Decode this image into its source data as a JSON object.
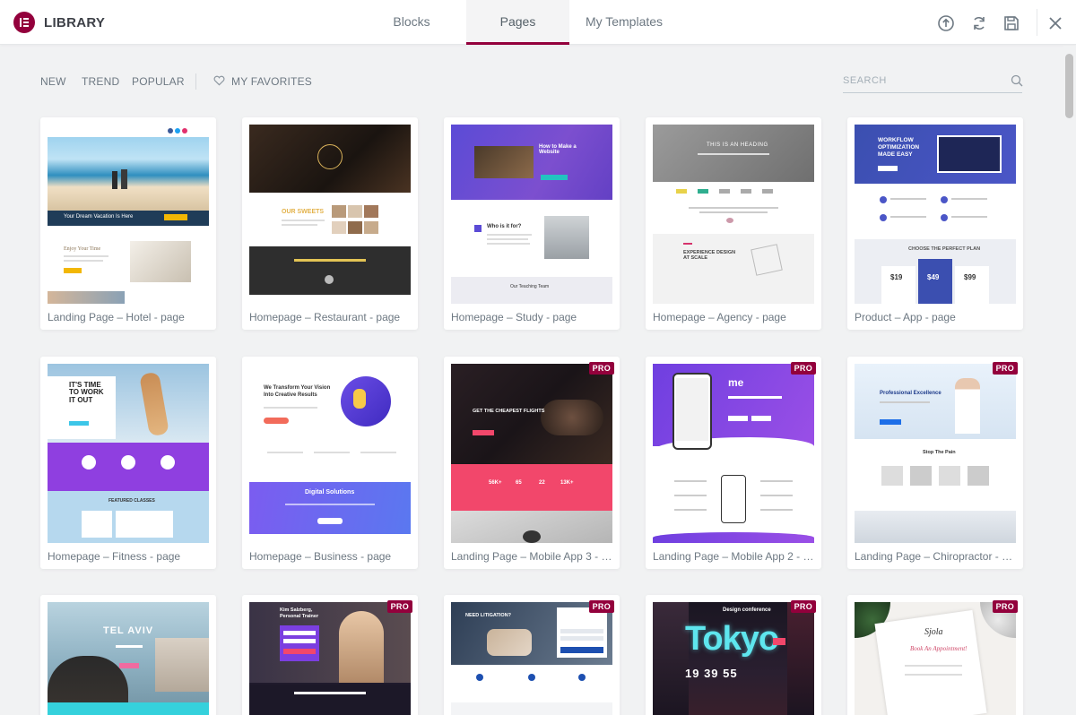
{
  "header": {
    "title": "LIBRARY",
    "tabs": [
      {
        "label": "Blocks",
        "active": false
      },
      {
        "label": "Pages",
        "active": true
      },
      {
        "label": "My Templates",
        "active": false
      }
    ],
    "icons": [
      "upload-icon",
      "sync-icon",
      "save-icon",
      "close-icon"
    ]
  },
  "toolbar": {
    "filters": [
      "NEW",
      "TREND",
      "POPULAR"
    ],
    "favorites_label": "MY FAVORITES",
    "search_placeholder": "SEARCH"
  },
  "colors": {
    "accent": "#93003c",
    "background": "#f1f2f3",
    "text": "#6d7882"
  },
  "templates": [
    {
      "label": "Landing Page – Hotel - page",
      "pro": false
    },
    {
      "label": "Homepage – Restaurant - page",
      "pro": false
    },
    {
      "label": "Homepage – Study - page",
      "pro": false
    },
    {
      "label": "Homepage – Agency - page",
      "pro": false
    },
    {
      "label": "Product – App - page",
      "pro": false
    },
    {
      "label": "Homepage – Fitness - page",
      "pro": false
    },
    {
      "label": "Homepage – Business - page",
      "pro": false
    },
    {
      "label": "Landing Page – Mobile App 3 - page",
      "pro": true
    },
    {
      "label": "Landing Page – Mobile App 2 - page",
      "pro": true
    },
    {
      "label": "Landing Page – Chiropractor - page",
      "pro": true
    },
    {
      "label": "",
      "pro": false
    },
    {
      "label": "",
      "pro": true
    },
    {
      "label": "",
      "pro": true
    },
    {
      "label": "",
      "pro": true
    },
    {
      "label": "",
      "pro": true
    }
  ],
  "pro_badge": "PRO",
  "preview_text": {
    "hotel_caption": "Your Dream Vacation Is Here",
    "hotel_sub": "Enjoy Your Time",
    "restaurant_heading": "OUR SWEETS",
    "study_heading": "How to Make a Website",
    "study_sub": "Who is it for?",
    "study_team": "Our Teaching Team",
    "agency_heading": "THIS IS AN HEADING",
    "agency_sub": "EXPERIENCE DESIGN AT SCALE",
    "app_heading": "WORKFLOW OPTIMIZATION MADE EASY",
    "app_plan": "CHOOSE THE PERFECT PLAN",
    "app_prices": [
      "$19",
      "$49",
      "$99"
    ],
    "fitness_heading": "IT'S TIME TO WORK IT OUT",
    "fitness_sub": "FEATURED CLASSES",
    "business_heading": "We Transform Your Vision Into Creative Results",
    "business_sub": "Digital Solutions",
    "mobile3_heading": "GET THE CHEAPEST FLIGHTS",
    "mobile3_stats": [
      "56K+",
      "65",
      "22",
      "13K+"
    ],
    "chiro_heading": "Professional Excellence",
    "chiro_sub": "Stop The Pain",
    "telaviv": "TEL AVIV",
    "trainer": "Kim Salzberg, Personal Trainer",
    "litigation": "NEED LITIGATION?",
    "tokyo": "Tokyo",
    "tokyo_sub": "Design conference",
    "tokyo_time": "19 39 55",
    "sjola": "Sjola",
    "sjola_sub": "Book An Appointment!"
  }
}
